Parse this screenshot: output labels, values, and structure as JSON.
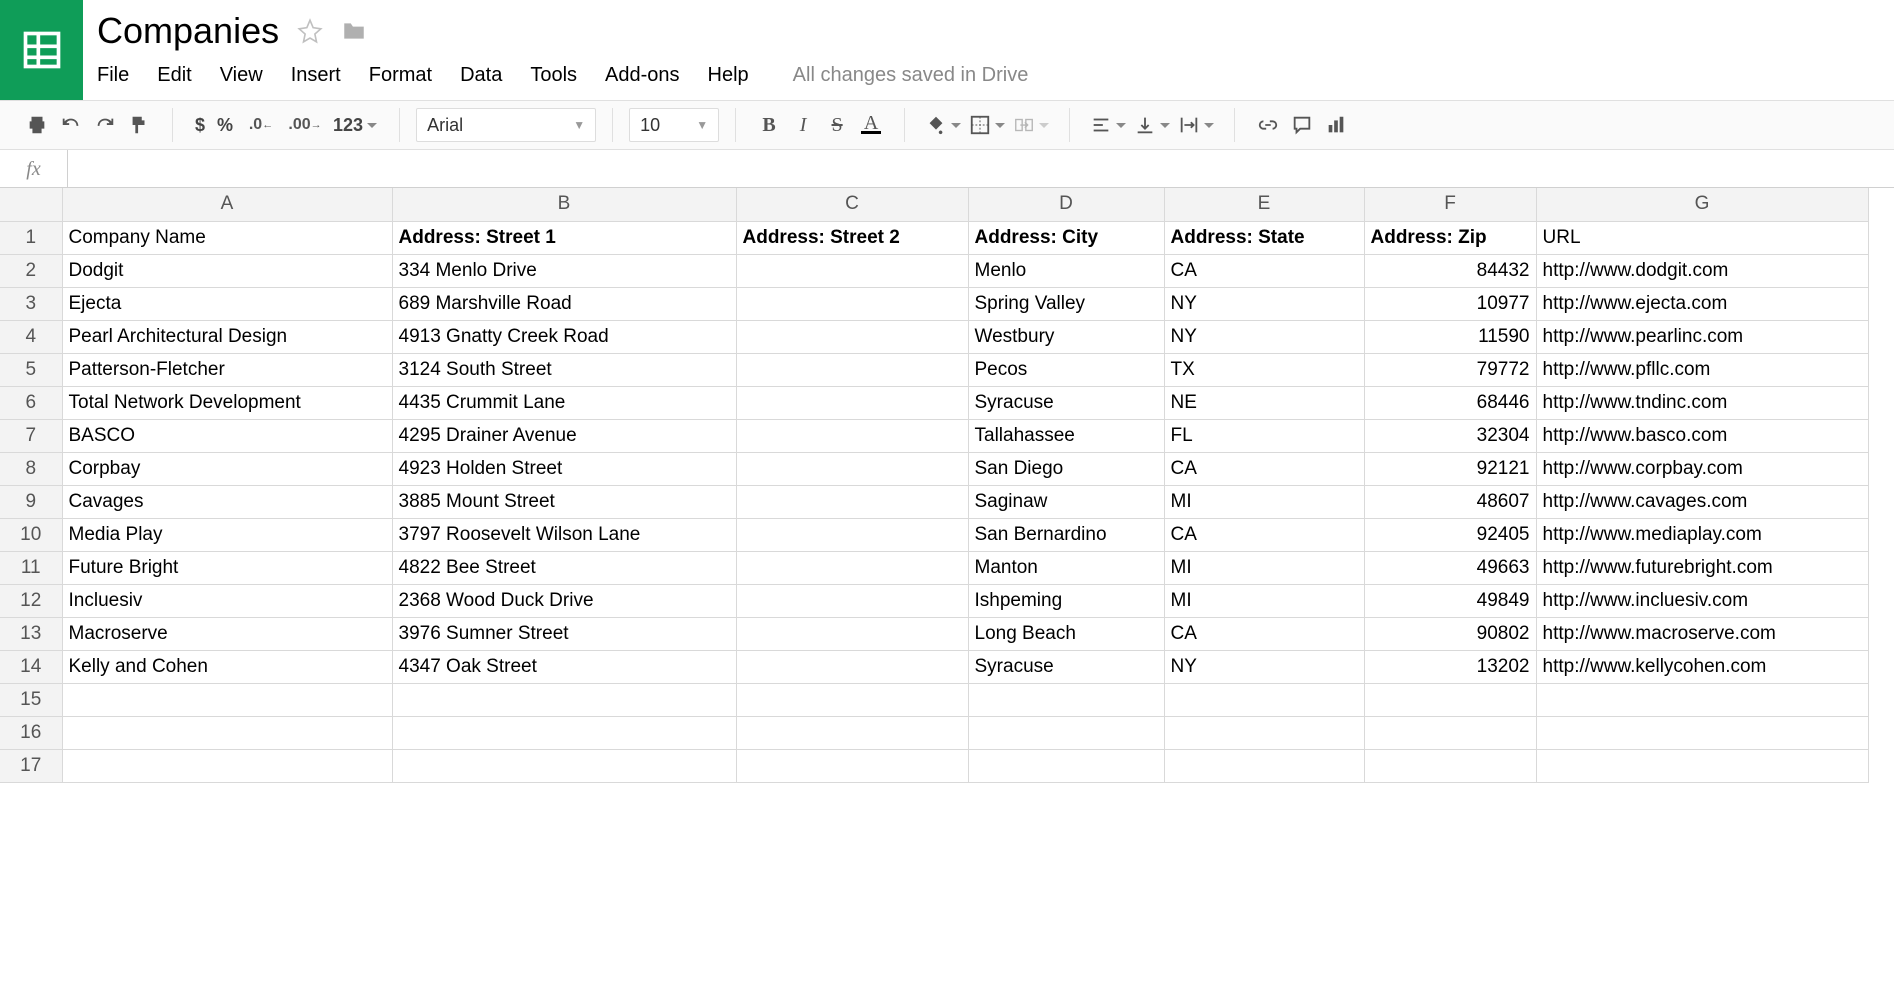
{
  "doc": {
    "title": "Companies",
    "save_status": "All changes saved in Drive"
  },
  "menus": {
    "file": "File",
    "edit": "Edit",
    "view": "View",
    "insert": "Insert",
    "format": "Format",
    "data": "Data",
    "tools": "Tools",
    "addons": "Add-ons",
    "help": "Help"
  },
  "toolbar": {
    "currency": "$",
    "percent": "%",
    "dec_dec": ".0_",
    "inc_dec": ".00_",
    "more_formats": "123",
    "font_name": "Arial",
    "font_size": "10",
    "bold": "B",
    "italic": "I",
    "strike": "S",
    "text_color": "A"
  },
  "formula": {
    "fx_label": "fx",
    "value": ""
  },
  "columns": [
    "A",
    "B",
    "C",
    "D",
    "E",
    "F",
    "G"
  ],
  "header_row": [
    {
      "text": "Company Name",
      "bold": false
    },
    {
      "text": "Address: Street 1",
      "bold": true
    },
    {
      "text": "Address: Street 2",
      "bold": true
    },
    {
      "text": "Address: City",
      "bold": true
    },
    {
      "text": "Address: State",
      "bold": true
    },
    {
      "text": "Address: Zip",
      "bold": true
    },
    {
      "text": "URL",
      "bold": false
    }
  ],
  "rows": [
    {
      "company": "Dodgit",
      "street1": "334 Menlo Drive",
      "street2": "",
      "city": "Menlo",
      "state": "CA",
      "zip": "84432",
      "url": "http://www.dodgit.com"
    },
    {
      "company": "Ejecta",
      "street1": "689 Marshville Road",
      "street2": "",
      "city": "Spring Valley",
      "state": "NY",
      "zip": "10977",
      "url": "http://www.ejecta.com"
    },
    {
      "company": "Pearl Architectural Design",
      "street1": "4913 Gnatty Creek Road",
      "street2": "",
      "city": "Westbury",
      "state": "NY",
      "zip": "11590",
      "url": "http://www.pearlinc.com"
    },
    {
      "company": "Patterson-Fletcher",
      "street1": "3124 South Street",
      "street2": "",
      "city": "Pecos",
      "state": "TX",
      "zip": "79772",
      "url": "http://www.pfllc.com"
    },
    {
      "company": "Total Network Development",
      "street1": "4435 Crummit Lane",
      "street2": "",
      "city": "Syracuse",
      "state": "NE",
      "zip": "68446",
      "url": "http://www.tndinc.com"
    },
    {
      "company": "BASCO",
      "street1": "4295 Drainer Avenue",
      "street2": "",
      "city": "Tallahassee",
      "state": "FL",
      "zip": "32304",
      "url": "http://www.basco.com"
    },
    {
      "company": "Corpbay",
      "street1": "4923 Holden Street",
      "street2": "",
      "city": "San Diego",
      "state": "CA",
      "zip": "92121",
      "url": "http://www.corpbay.com"
    },
    {
      "company": "Cavages",
      "street1": "3885 Mount Street",
      "street2": "",
      "city": "Saginaw",
      "state": "MI",
      "zip": "48607",
      "url": "http://www.cavages.com"
    },
    {
      "company": "Media Play",
      "street1": "3797 Roosevelt Wilson Lane",
      "street2": "",
      "city": "San Bernardino",
      "state": "CA",
      "zip": "92405",
      "url": "http://www.mediaplay.com"
    },
    {
      "company": "Future Bright",
      "street1": "4822 Bee Street",
      "street2": "",
      "city": "Manton",
      "state": "MI",
      "zip": "49663",
      "url": "http://www.futurebright.com"
    },
    {
      "company": "Incluesiv",
      "street1": "2368 Wood Duck Drive",
      "street2": "",
      "city": "Ishpeming",
      "state": "MI",
      "zip": "49849",
      "url": "http://www.incluesiv.com"
    },
    {
      "company": "Macroserve",
      "street1": "3976 Sumner Street",
      "street2": "",
      "city": "Long Beach",
      "state": "CA",
      "zip": "90802",
      "url": "http://www.macroserve.com"
    },
    {
      "company": "Kelly and Cohen",
      "street1": "4347 Oak Street",
      "street2": "",
      "city": "Syracuse",
      "state": "NY",
      "zip": "13202",
      "url": "http://www.kellycohen.com"
    }
  ],
  "empty_rows": [
    15,
    16,
    17
  ]
}
